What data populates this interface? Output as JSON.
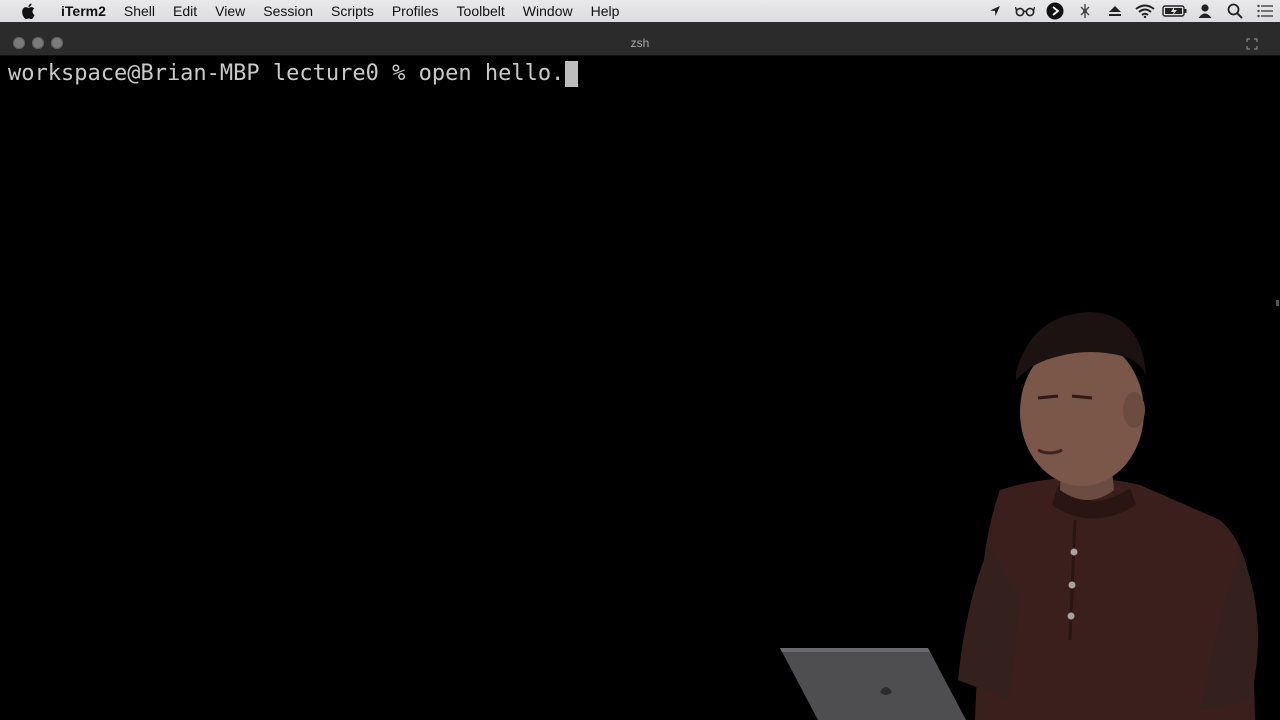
{
  "menubar": {
    "app_name": "iTerm2",
    "items": [
      "Shell",
      "Edit",
      "View",
      "Session",
      "Scripts",
      "Profiles",
      "Toolbelt",
      "Window",
      "Help"
    ],
    "status_icons": [
      "location-icon",
      "glasses-icon",
      "play-circle-icon",
      "dropbox-icon",
      "eject-icon",
      "wifi-icon",
      "battery-charging-icon",
      "user-icon",
      "spotlight-search-icon",
      "notification-center-icon"
    ]
  },
  "window": {
    "title": "zsh"
  },
  "terminal": {
    "prompt": "workspace@Brian-MBP lecture0 % ",
    "command": "open hello."
  },
  "colors": {
    "menubar_bg": "#e3e2e4",
    "titlebar_bg": "#2b2b2b",
    "terminal_bg": "#000000",
    "terminal_fg": "#c9c9c9",
    "cursor": "#bdbdbd"
  }
}
